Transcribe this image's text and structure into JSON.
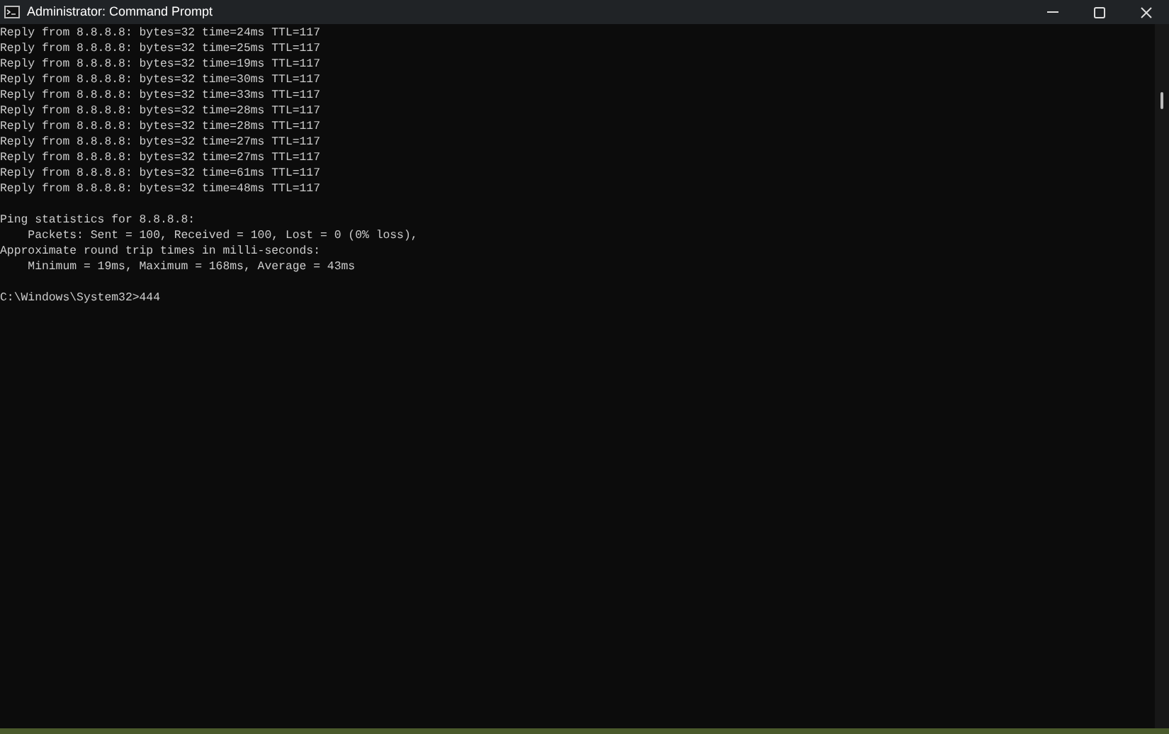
{
  "window": {
    "title": "Administrator: Command Prompt"
  },
  "console": {
    "blocks": [
      {
        "lines": [
          "Reply from 8.8.8.8: bytes=32 time=24ms TTL=117",
          "Reply from 8.8.8.8: bytes=32 time=25ms TTL=117",
          "Reply from 8.8.8.8: bytes=32 time=19ms TTL=117",
          "Reply from 8.8.8.8: bytes=32 time=30ms TTL=117",
          "Reply from 8.8.8.8: bytes=32 time=33ms TTL=117",
          "Reply from 8.8.8.8: bytes=32 time=28ms TTL=117",
          "Reply from 8.8.8.8: bytes=32 time=28ms TTL=117",
          "Reply from 8.8.8.8: bytes=32 time=27ms TTL=117",
          "Reply from 8.8.8.8: bytes=32 time=27ms TTL=117",
          "Reply from 8.8.8.8: bytes=32 time=61ms TTL=117",
          "Reply from 8.8.8.8: bytes=32 time=48ms TTL=117"
        ]
      },
      {
        "lines": [
          "Ping statistics for 8.8.8.8:",
          "    Packets: Sent = 100, Received = 100, Lost = 0 (0% loss),",
          "Approximate round trip times in milli-seconds:",
          "    Minimum = 19ms, Maximum = 168ms, Average = 43ms"
        ]
      },
      {
        "lines": [
          "C:\\Windows\\System32>444"
        ]
      }
    ]
  }
}
